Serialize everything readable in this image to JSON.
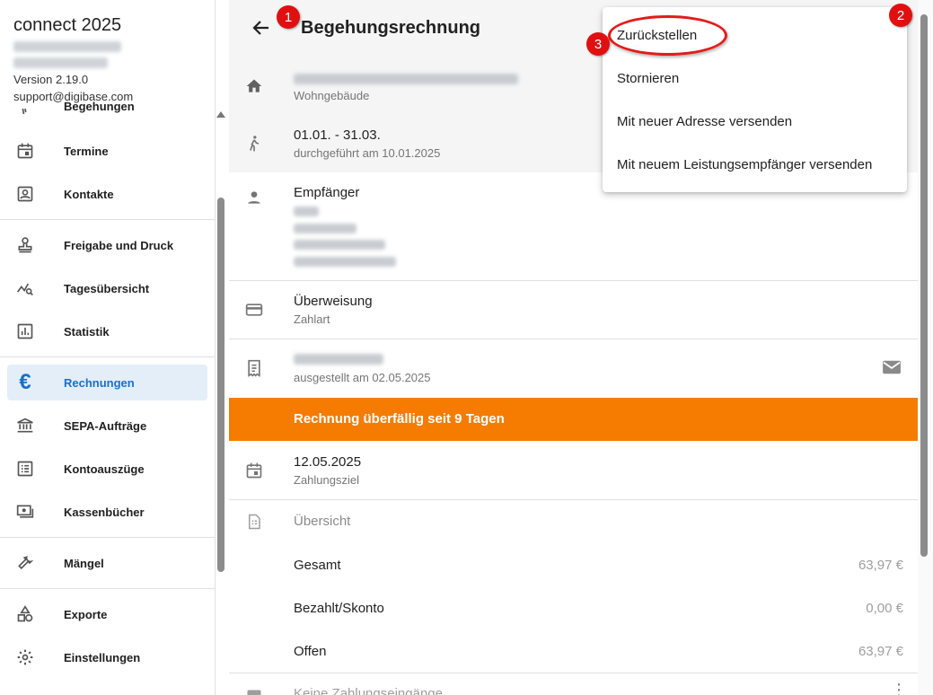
{
  "sidebar": {
    "app_title": "connect 2025",
    "version": "Version 2.19.0",
    "support": "support@digibase.com",
    "cut_item": "Begehungen",
    "items": [
      {
        "label": "Termine",
        "icon": "calendar-icon"
      },
      {
        "label": "Kontakte",
        "icon": "contacts-icon"
      },
      {
        "label": "Freigabe und Druck",
        "icon": "stamp-icon"
      },
      {
        "label": "Tagesübersicht",
        "icon": "chart-search-icon"
      },
      {
        "label": "Statistik",
        "icon": "bar-chart-icon"
      },
      {
        "label": "Rechnungen",
        "icon": "euro-icon",
        "active": true
      },
      {
        "label": "SEPA-Aufträge",
        "icon": "bank-icon"
      },
      {
        "label": "Kontoauszüge",
        "icon": "list-icon"
      },
      {
        "label": "Kassenbücher",
        "icon": "cash-icon"
      },
      {
        "label": "Mängel",
        "icon": "wrench-icon"
      },
      {
        "label": "Exporte",
        "icon": "shapes-icon"
      },
      {
        "label": "Einstellungen",
        "icon": "gear-icon"
      }
    ]
  },
  "header": {
    "title": "Begehungsrechnung"
  },
  "details": {
    "building_type": "Wohngebäude",
    "period": "01.01. - 31.03.",
    "performed": "durchgeführt am 10.01.2025",
    "recipient_label": "Empfänger",
    "payment_method": "Überweisung",
    "payment_method_label": "Zahlart",
    "issued": "ausgestellt am 02.05.2025",
    "overdue": "Rechnung überfällig seit 9 Tagen",
    "due_date": "12.05.2025",
    "due_date_label": "Zahlungsziel",
    "overview_label": "Übersicht",
    "totals": [
      {
        "label": "Gesamt",
        "value": "63,97 €"
      },
      {
        "label": "Bezahlt/Skonto",
        "value": "0,00 €"
      },
      {
        "label": "Offen",
        "value": "63,97 €"
      }
    ],
    "payments_label": "Keine Zahlungseingänge"
  },
  "menu": {
    "items": [
      "Zurückstellen",
      "Stornieren",
      "Mit neuer Adresse versenden",
      "Mit neuem Leistungsempfänger versenden"
    ]
  },
  "annotations": {
    "badges": [
      "1",
      "2",
      "3"
    ],
    "highlight_color": "#e31b1b"
  },
  "colors": {
    "accent": "#1a6fc9",
    "overdue": "#f57c00"
  }
}
